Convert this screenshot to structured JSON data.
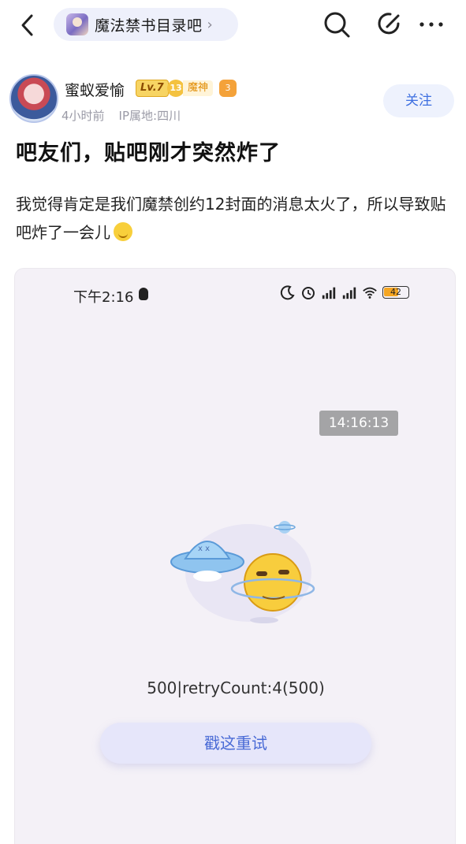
{
  "header": {
    "forum_name": "魔法禁书目录吧",
    "chevron": "›",
    "icons": [
      "back-icon",
      "search-icon",
      "edit-icon",
      "more-icon"
    ]
  },
  "author": {
    "name": "蜜蚁爱愉",
    "level": "Lv.7",
    "rank_number": "13",
    "rank_title": "魔神",
    "fan_badge": "3",
    "time": "4小时前",
    "ip": "IP属地:四川",
    "follow_label": "关注"
  },
  "post": {
    "title": "吧友们，贴吧刚才突然炸了",
    "body": "我觉得肯定是我们魔禁创约12封面的消息太火了，所以导致贴吧炸了一会儿"
  },
  "screenshot": {
    "status_time": "下午2:16",
    "battery": "42",
    "timestamp": "14:16:13",
    "error_text": "500|retryCount:4(500)",
    "retry_label": "戳这重试"
  },
  "colors": {
    "accent": "#3d6fe0",
    "pill_bg": "#eef0fb",
    "retry_bg": "#e6e6fa"
  }
}
